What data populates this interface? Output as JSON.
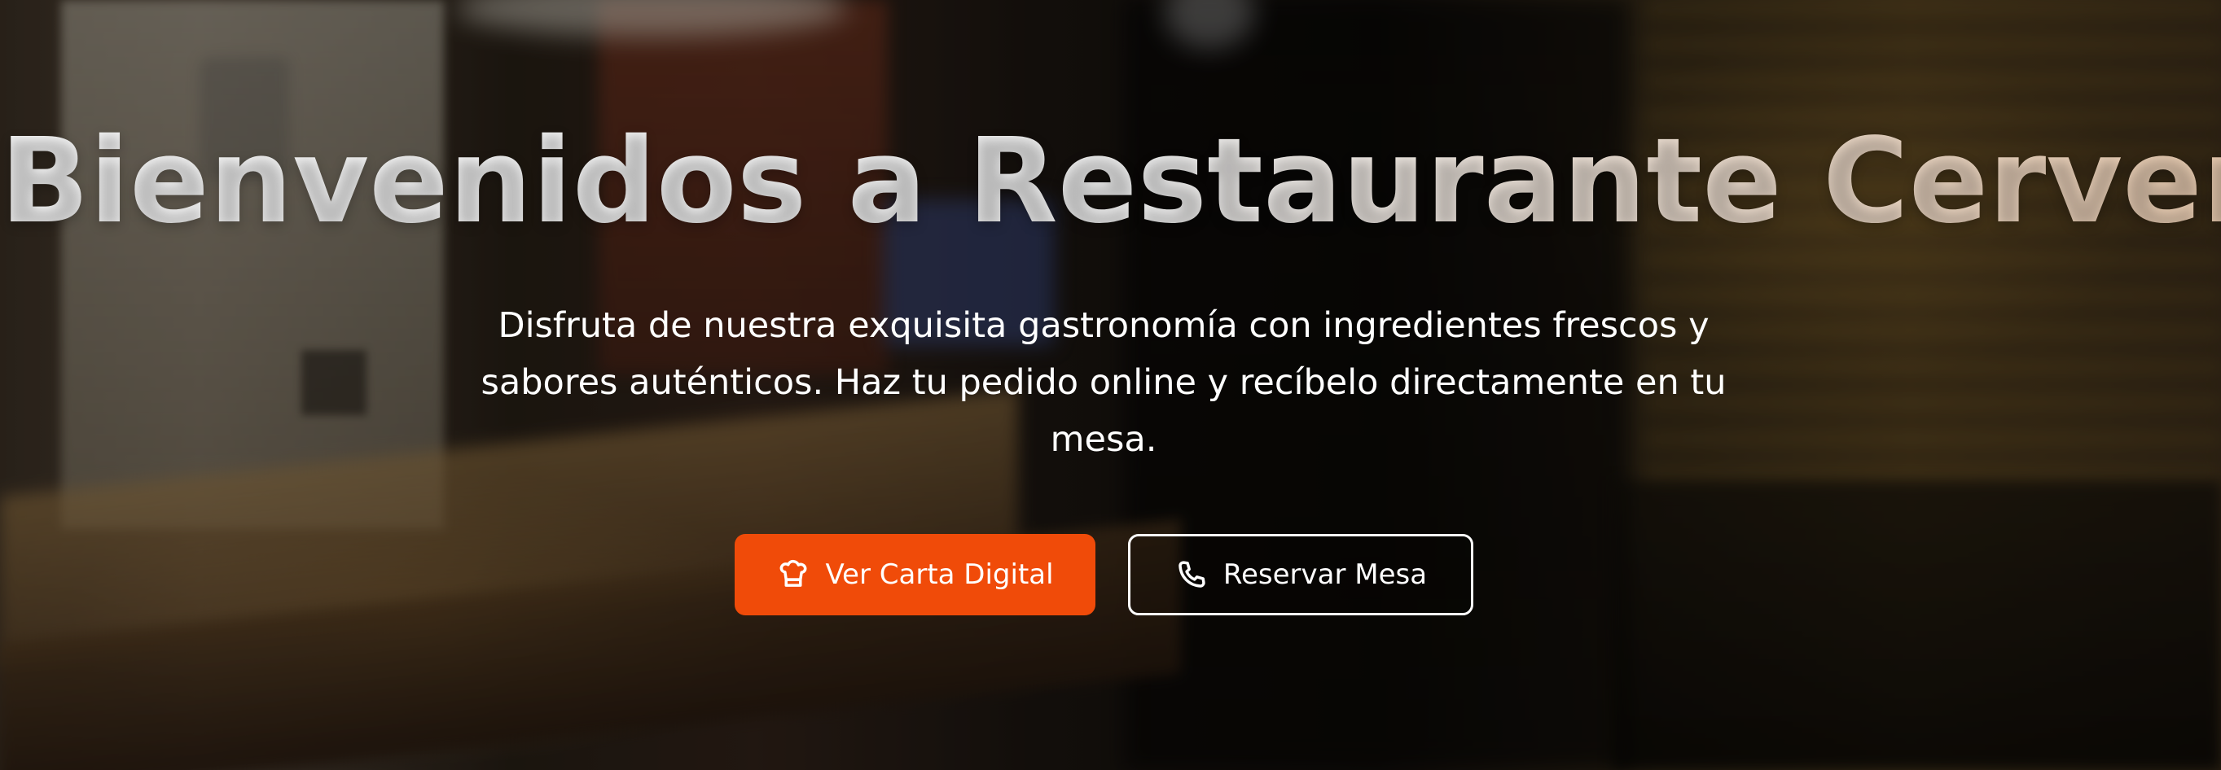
{
  "hero": {
    "title": "Bienvenidos a Restaurante Cervereta",
    "subtitle": "Disfruta de nuestra exquisita gastronomía con ingredientes frescos y sabores auténticos. Haz tu pedido online y recíbelo directamente en tu mesa.",
    "primary_button": {
      "label": "Ver Carta Digital",
      "icon": "chef-hat-icon",
      "color": "#F04B09"
    },
    "secondary_button": {
      "label": "Reservar Mesa",
      "icon": "phone-icon",
      "color": "#FFFFFF"
    }
  }
}
